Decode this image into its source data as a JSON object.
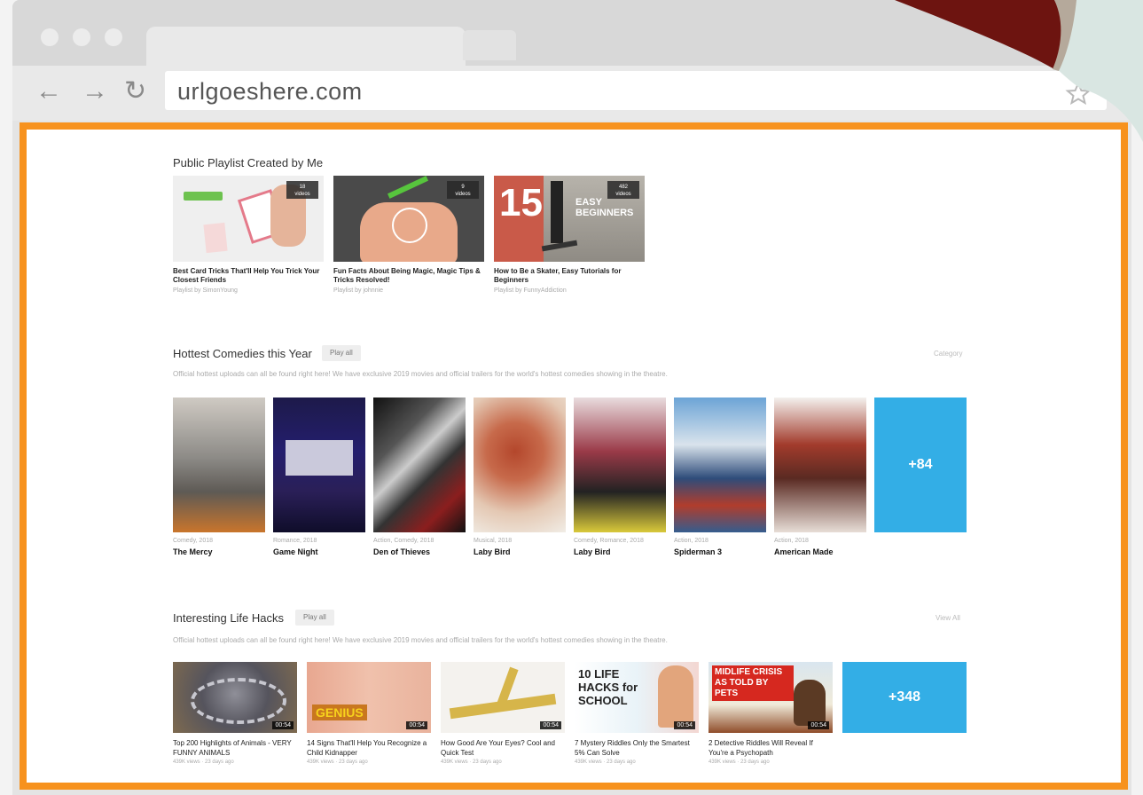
{
  "browser": {
    "url": "urlgoeshere.com",
    "back_glyph": "←",
    "forward_glyph": "→",
    "reload_glyph": "↻"
  },
  "playlists": {
    "title": "Public Playlist Created by Me",
    "items": [
      {
        "badge_count": "18",
        "badge_unit": "videos",
        "title": "Best Card Tricks That'll Help You Trick Your Closest Friends",
        "sub": "Playlist by SimonYoung"
      },
      {
        "badge_count": "9",
        "badge_unit": "videos",
        "title": "Fun Facts About Being Magic, Magic Tips & Tricks Resolved!",
        "sub": "Playlist by johnnie"
      },
      {
        "badge_count": "482",
        "badge_unit": "videos",
        "overlay_num": "15",
        "overlay_text": "EASY BEGINNERS",
        "title": "How to Be a Skater, Easy Tutorials for Beginners",
        "sub": "Playlist by FunnyAddiction"
      }
    ]
  },
  "comedies": {
    "title": "Hottest Comedies this Year",
    "play_all": "Play all",
    "right_link": "Category",
    "description": "Official hottest uploads can all be found right here! We have exclusive 2019 movies and official trailers for the world's hottest comedies showing in the theatre.",
    "items": [
      {
        "genre": "Comedy, 2018",
        "title": "The Mercy"
      },
      {
        "genre": "Romance, 2018",
        "title": "Game Night"
      },
      {
        "genre": "Action, Comedy, 2018",
        "title": "Den of Thieves"
      },
      {
        "genre": "Musical, 2018",
        "title": "Laby Bird"
      },
      {
        "genre": "Comedy, Romance, 2018",
        "title": "Laby Bird"
      },
      {
        "genre": "Action, 2018",
        "title": "Spiderman 3"
      },
      {
        "genre": "Action, 2018",
        "title": "American Made"
      }
    ],
    "more": "+84"
  },
  "hacks": {
    "title": "Interesting Life Hacks",
    "play_all": "Play all",
    "right_link": "View All",
    "description": "Official hottest uploads can all be found right here! We have exclusive 2019 movies and official trailers for the world's hottest comedies showing in the theatre.",
    "items": [
      {
        "duration": "00:54",
        "title": "Top 200 Highlights of Animals - VERY FUNNY ANIMALS",
        "meta": "439K views · 23 days ago"
      },
      {
        "duration": "00:54",
        "overlay": "GENIUS",
        "title": "14 Signs That'll Help You Recognize a Child Kidnapper",
        "meta": "439K views · 23 days ago"
      },
      {
        "duration": "00:54",
        "title": "How Good Are Your Eyes? Cool and Quick Test",
        "meta": "439K views · 23 days ago"
      },
      {
        "duration": "00:54",
        "overlay": "10 LIFE HACKS for SCHOOL",
        "title": "7 Mystery Riddles Only the Smartest 5% Can Solve",
        "meta": "439K views · 23 days ago"
      },
      {
        "duration": "00:54",
        "overlay": "MIDLIFE CRISIS AS TOLD BY PETS",
        "title": "2 Detective Riddles Will Reveal If You're a Psychopath",
        "meta": "439K views · 23 days ago"
      }
    ],
    "more": "+348"
  },
  "colors": {
    "frame": "#f7921e",
    "accent_tile": "#33aee6"
  }
}
